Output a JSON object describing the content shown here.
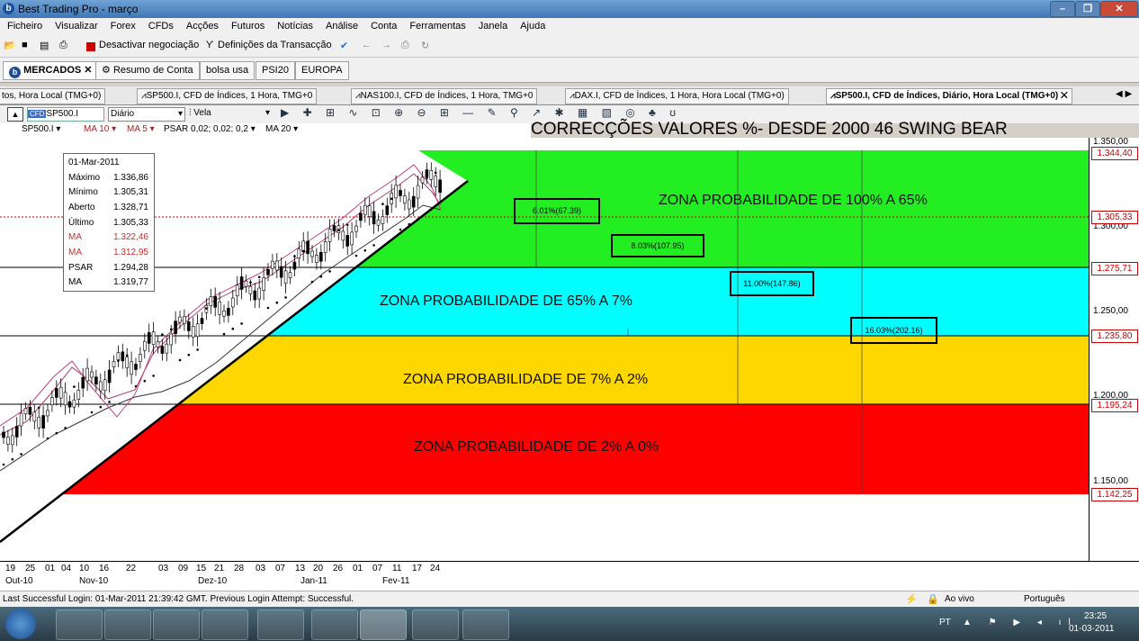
{
  "window": {
    "title": "Best Trading Pro - março",
    "app_icon": "b"
  },
  "menu": [
    "Ficheiro",
    "Visualizar",
    "Forex",
    "CFDs",
    "Acções",
    "Futuros",
    "Notícias",
    "Análise",
    "Conta",
    "Ferramentas",
    "Janela",
    "Ajuda"
  ],
  "toolbar": {
    "deactivate": "Desactivar negociação",
    "settings": "Definições da Transacção"
  },
  "tabs1": [
    "MERCADOS",
    "Resumo de Conta",
    "bolsa usa",
    "PSI20",
    "EUROPA"
  ],
  "tabs2": [
    "tos, Hora Local (TMG+0)",
    "SP500.I, CFD de Índices, 1 Hora, TMG+0",
    "NAS100.I, CFD de Índices, 1 Hora, TMG+0",
    "DAX.I, CFD de Índices, 1 Hora, Hora Local (TMG+0)",
    "SP500.I, CFD de Índices, Diário, Hora Local (TMG+0)"
  ],
  "controls": {
    "symbol": "SP500.I",
    "period": "Diário",
    "chart_type": "Vela"
  },
  "indicators": [
    "SP500.I ▾",
    "MA 10 ▾",
    "MA 5 ▾",
    "PSAR 0,02; 0,02; 0,2 ▾",
    "MA 20 ▾"
  ],
  "headline": "CORRECÇÕES VALORES %- DESDE 2000    46 SWING BEAR",
  "zones": [
    {
      "label": "ZONA PROBABILIDADE DE 100% A 65%",
      "color": "#22ee22"
    },
    {
      "label": "ZONA PROBABILIDADE DE 65% A 7%",
      "color": "#00ffff"
    },
    {
      "label": "ZONA PROBABILIDADE DE 7% A 2%",
      "color": "#ffd700"
    },
    {
      "label": "ZONA PROBABILIDADE DE 2% A 0%",
      "color": "#ff0000"
    }
  ],
  "boxes": [
    "6.01%(67.39)",
    "8.03%(107.95)",
    "11.00%(147.86)",
    "16.03%(202.16)"
  ],
  "infobox": {
    "date": "01-Mar-2011",
    "rows": [
      {
        "k": "Máximo",
        "v": "1.336,86"
      },
      {
        "k": "Mínimo",
        "v": "1.305,31"
      },
      {
        "k": "Aberto",
        "v": "1.328,71"
      },
      {
        "k": "Último",
        "v": "1.305,33"
      },
      {
        "k": "MA",
        "v": "1.322,46"
      },
      {
        "k": "MA",
        "v": "1.312,95"
      },
      {
        "k": "PSAR",
        "v": "1.294,28"
      },
      {
        "k": "MA",
        "v": "1.319,77"
      }
    ]
  },
  "yaxis": {
    "ticks": [
      "1.350,00",
      "1.300,00",
      "1.250,00",
      "1.200,00",
      "1.150,00"
    ],
    "labels": [
      "1.344,40",
      "1.305,33",
      "1.275,71",
      "1.235,80",
      "1.195,24",
      "1.142,25"
    ]
  },
  "xaxis": {
    "days": [
      "19",
      "25",
      "01",
      "04",
      "10",
      "16",
      "22",
      "03",
      "09",
      "15",
      "21",
      "28",
      "03",
      "07",
      "13",
      "20",
      "26",
      "01",
      "07",
      "11",
      "17",
      "24"
    ],
    "months": [
      "Out-10",
      "Nov-10",
      "Dez-10",
      "Jan-11",
      "Fev-11"
    ]
  },
  "status": {
    "login": "Last Successful Login: 01-Mar-2011 21:39:42 GMT. Previous Login Attempt: Successful.",
    "live": "Ao vivo",
    "lang": "Português"
  },
  "taskbar": {
    "lang": "PT",
    "time": "23:25",
    "date": "01-03-2011"
  }
}
